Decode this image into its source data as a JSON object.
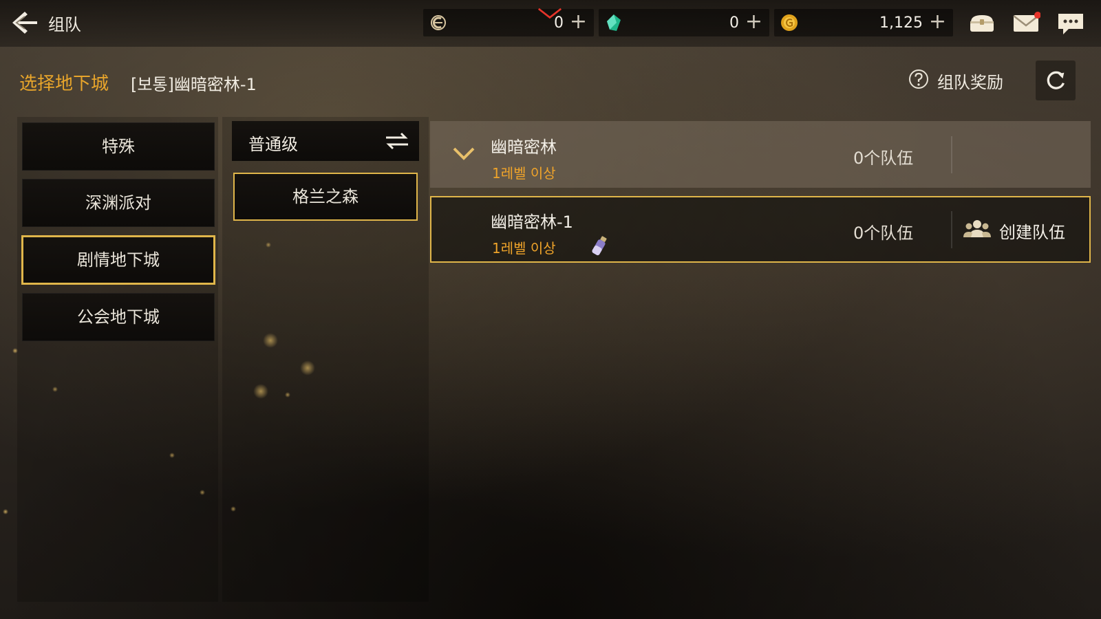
{
  "header": {
    "title": "组队"
  },
  "currencies": [
    {
      "icon": "moon-coin-icon",
      "value": "0"
    },
    {
      "icon": "green-gem-icon",
      "value": "0"
    },
    {
      "icon": "gold-coin-icon",
      "value": "1,125"
    }
  ],
  "topIcons": [
    "treasure-chest-icon",
    "mail-icon",
    "chat-icon"
  ],
  "selection": {
    "label": "选择地下城",
    "value": "[보통]幽暗密林-1"
  },
  "actions": {
    "reward_label": "组队奖励"
  },
  "categories": [
    "特殊",
    "深渊派对",
    "剧情地下城",
    "公会地下城"
  ],
  "difficulty": {
    "label": "普通级"
  },
  "area": {
    "label": "格兰之森"
  },
  "dungeons": [
    {
      "name": "幽暗密林",
      "level": "1레벨 이상",
      "teams": "0个队伍"
    },
    {
      "name": "幽暗密林-1",
      "level": "1레벨 이상",
      "teams": "0个队伍",
      "action": "创建队伍"
    }
  ],
  "colors": {
    "accent": "#e8a52b",
    "selected_border": "#e0b64a",
    "level_text": "#f0a42a",
    "notification": "#e6342a"
  }
}
